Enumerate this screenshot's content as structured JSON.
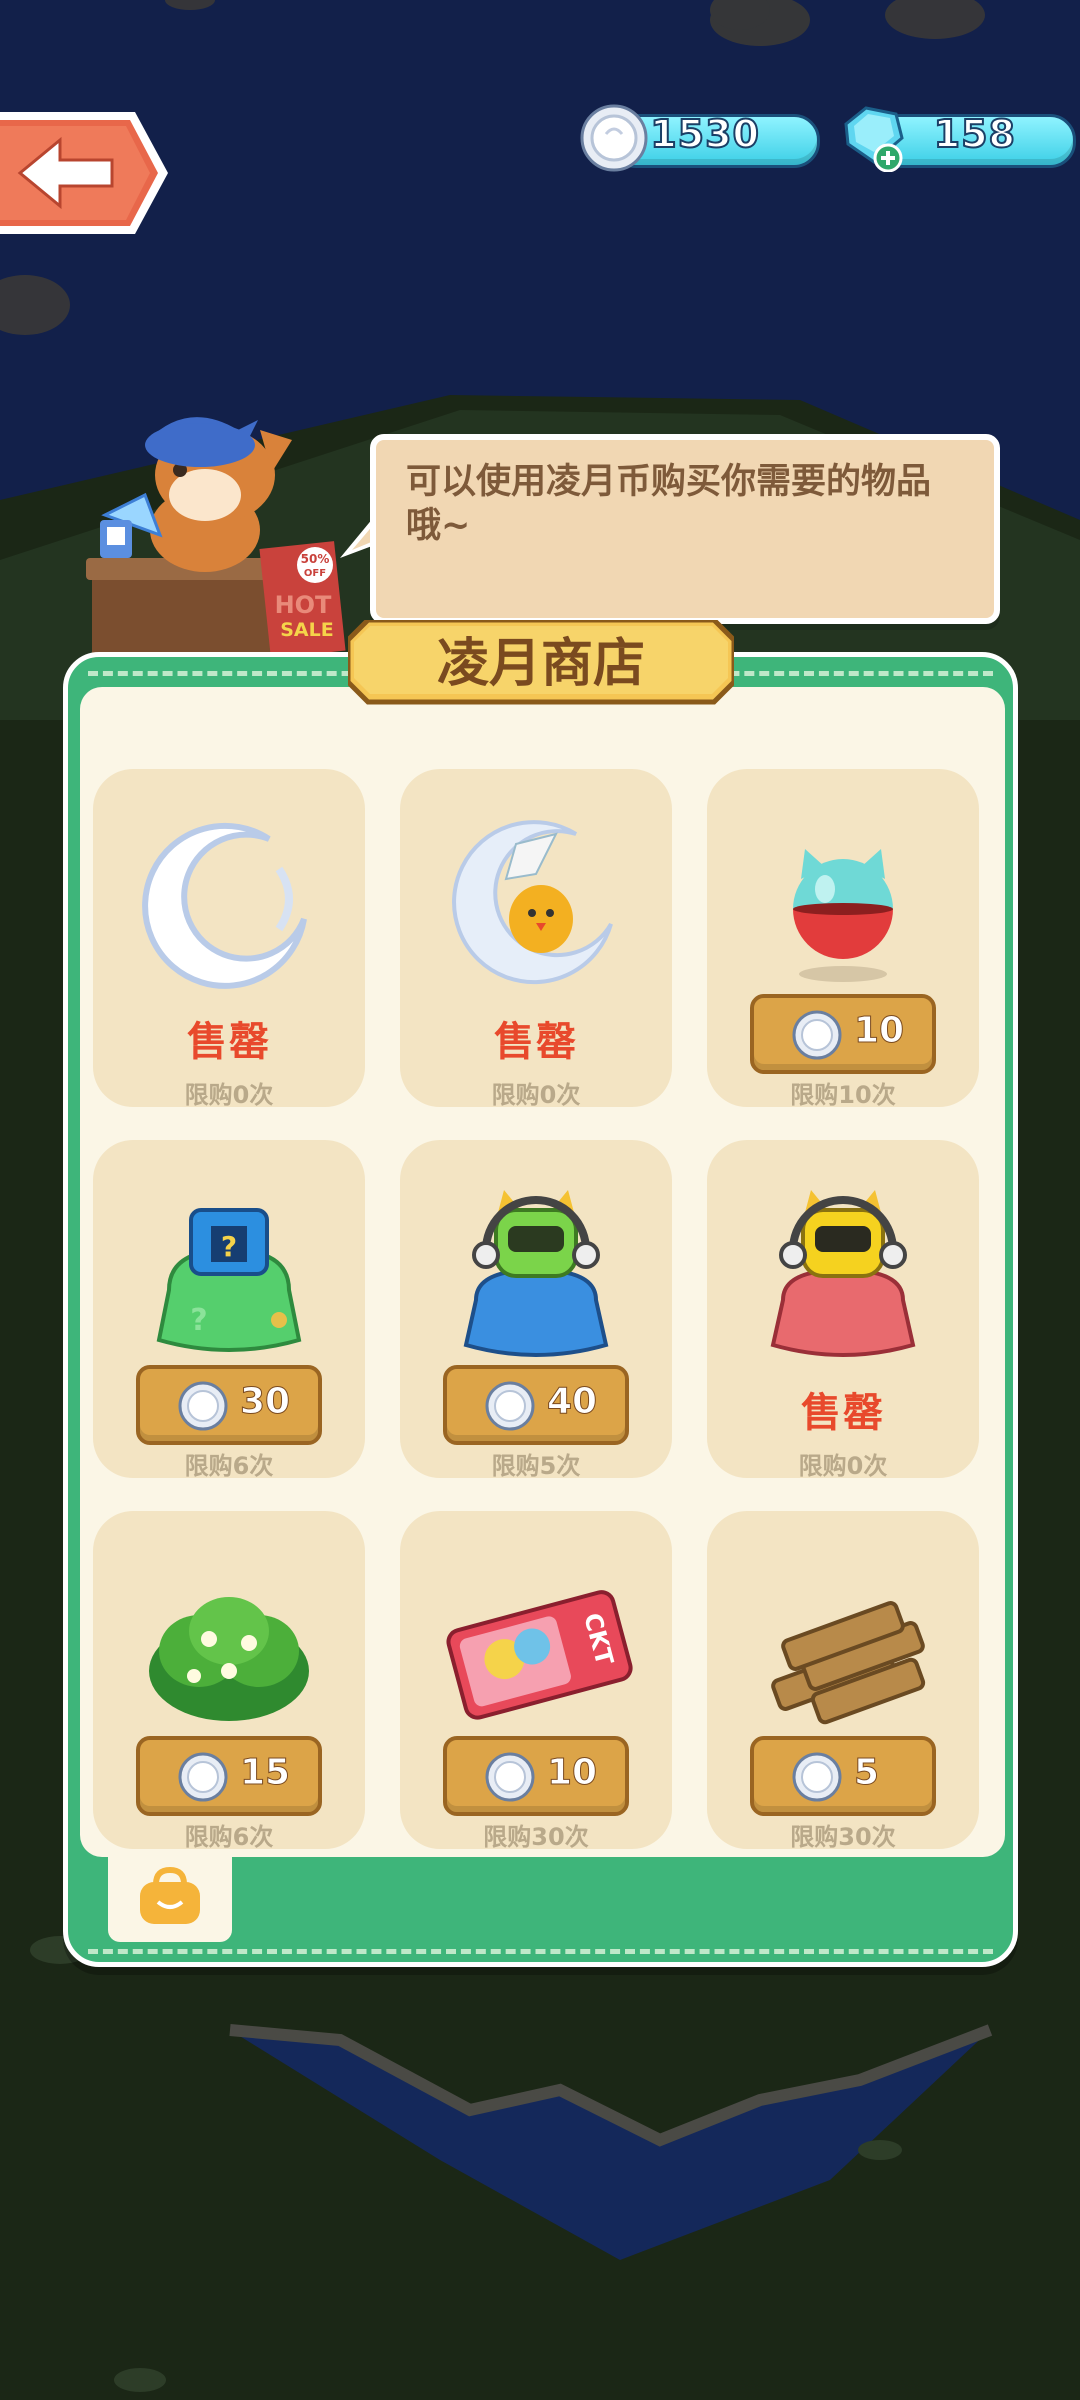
{
  "header": {
    "coins": "1530",
    "gems": "158"
  },
  "npc": {
    "sign_percent": "50%",
    "sign_off": "OFF",
    "sign_hot": "HOT",
    "sign_sale": "SALE",
    "dialog": "可以使用凌月币购买你需要的物品哦~"
  },
  "shop": {
    "title": "凌月商店",
    "items": [
      {
        "name": "moon-ring",
        "status": "售罄",
        "limit": "限购0次"
      },
      {
        "name": "moon-chick",
        "status": "售罄",
        "limit": "限购0次"
      },
      {
        "name": "capsule",
        "price": "10",
        "limit": "限购10次"
      },
      {
        "name": "mystery-bag",
        "price": "30",
        "limit": "限购6次"
      },
      {
        "name": "green-robot-bag",
        "price": "40",
        "limit": "限购5次"
      },
      {
        "name": "yellow-robot-bag",
        "status": "售罄",
        "limit": "限购0次"
      },
      {
        "name": "bush",
        "price": "15",
        "limit": "限购6次"
      },
      {
        "name": "ticket",
        "price": "10",
        "limit": "限购30次"
      },
      {
        "name": "wood-logs",
        "price": "5",
        "limit": "限购30次"
      }
    ],
    "ticket_text": "CKT"
  },
  "colors": {
    "panel": "#3eb57a",
    "sold": "#e8492c",
    "price_btn": "#dca448"
  }
}
